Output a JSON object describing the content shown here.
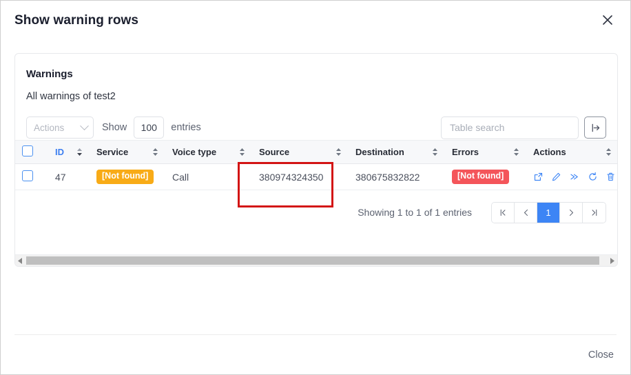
{
  "dialog": {
    "title": "Show warning rows",
    "close_icon": "close-icon",
    "footer_close_label": "Close"
  },
  "card": {
    "title": "Warnings",
    "subtitle": "All warnings of test2"
  },
  "toolbar": {
    "actions_label": "Actions",
    "actions_chevron_icon": "chevron-down-icon",
    "show_label": "Show",
    "entries_value": "100",
    "entries_label": "entries",
    "search_placeholder": "Table search",
    "search_value": "",
    "submit_icon": "arrow-right-from-bar-icon"
  },
  "table": {
    "columns": [
      {
        "label": "",
        "name": "select-all",
        "sorted": false,
        "sortable": false
      },
      {
        "label": "ID",
        "name": "id",
        "sorted": true,
        "sortable": true
      },
      {
        "label": "Service",
        "name": "service",
        "sorted": false,
        "sortable": true
      },
      {
        "label": "Voice type",
        "name": "voice-type",
        "sorted": false,
        "sortable": true
      },
      {
        "label": "Source",
        "name": "source",
        "sorted": false,
        "sortable": true
      },
      {
        "label": "Destination",
        "name": "destination",
        "sorted": false,
        "sortable": true
      },
      {
        "label": "Errors",
        "name": "errors",
        "sorted": false,
        "sortable": true
      },
      {
        "label": "Actions",
        "name": "actions",
        "sorted": false,
        "sortable": true
      }
    ],
    "rows": [
      {
        "id": "47",
        "service": "[Not found]",
        "service_badge": "warn",
        "voice_type": "Call",
        "source": "380974324350",
        "destination": "380675832822",
        "errors": "[Not found]",
        "errors_badge": "err",
        "action_icons": [
          "external-link-icon",
          "pencil-edit-icon",
          "double-chevron-right-icon",
          "refresh-icon",
          "trash-icon"
        ]
      }
    ]
  },
  "paging": {
    "showing_text": "Showing 1 to 1 of 1 entries",
    "first_icon": "first-page-icon",
    "prev_icon": "prev-page-icon",
    "current_page": "1",
    "next_icon": "next-page-icon",
    "last_icon": "last-page-icon"
  },
  "highlight": {
    "color": "#d31414",
    "target_column": "Source"
  },
  "colors": {
    "accent_blue": "#3d85f5",
    "warn_orange": "#f8ab17",
    "error_red": "#f4555a",
    "annotation_red": "#d31414"
  }
}
